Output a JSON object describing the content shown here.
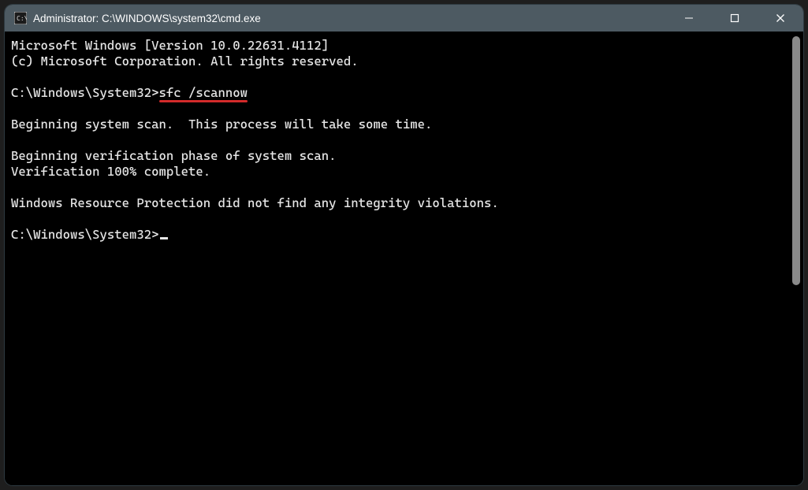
{
  "window": {
    "title": "Administrator: C:\\WINDOWS\\system32\\cmd.exe"
  },
  "terminal": {
    "line1": "Microsoft Windows [Version 10.0.22631.4112]",
    "line2": "(c) Microsoft Corporation. All rights reserved.",
    "blank1": "",
    "prompt1_path": "C:\\Windows\\System32>",
    "prompt1_cmd": "sfc /scannow",
    "blank2": "",
    "line3": "Beginning system scan.  This process will take some time.",
    "blank3": "",
    "line4": "Beginning verification phase of system scan.",
    "line5": "Verification 100% complete.",
    "blank4": "",
    "line6": "Windows Resource Protection did not find any integrity violations.",
    "blank5": "",
    "prompt2_path": "C:\\Windows\\System32>"
  }
}
